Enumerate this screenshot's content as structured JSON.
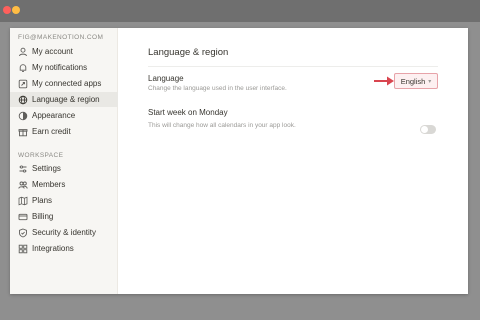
{
  "sidebar": {
    "account_email": "FIG@MAKENOTION.COM",
    "account_items": [
      {
        "label": "My account",
        "icon": "user-icon"
      },
      {
        "label": "My notifications",
        "icon": "bell-icon"
      },
      {
        "label": "My connected apps",
        "icon": "link-icon"
      },
      {
        "label": "Language & region",
        "icon": "globe-icon"
      },
      {
        "label": "Appearance",
        "icon": "appearance-icon"
      },
      {
        "label": "Earn credit",
        "icon": "gift-icon"
      }
    ],
    "workspace_label": "WORKSPACE",
    "workspace_items": [
      {
        "label": "Settings",
        "icon": "sliders-icon"
      },
      {
        "label": "Members",
        "icon": "people-icon"
      },
      {
        "label": "Plans",
        "icon": "map-icon"
      },
      {
        "label": "Billing",
        "icon": "card-icon"
      },
      {
        "label": "Security & identity",
        "icon": "shield-icon"
      },
      {
        "label": "Integrations",
        "icon": "grid-icon"
      }
    ],
    "active_item": "Language & region"
  },
  "main": {
    "title": "Language & region",
    "language": {
      "label": "Language",
      "description": "Change the language used in the user interface.",
      "value": "English"
    },
    "start_week": {
      "label": "Start week on Monday",
      "description": "This will change how all calendars in your app look.",
      "enabled": false
    }
  },
  "colors": {
    "highlight_border": "#e7a3a9",
    "arrow": "#d9454f",
    "sidebar_bg": "#f7f6f3"
  }
}
